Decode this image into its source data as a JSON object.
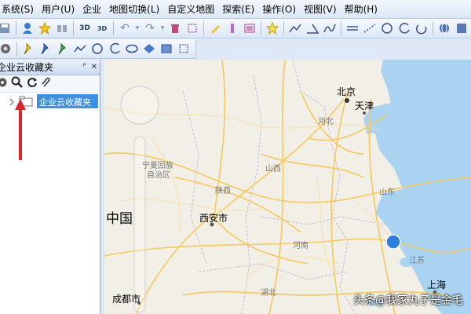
{
  "menu": [
    "系统(S)",
    "用户(U)",
    "企业",
    "地图切换(L)",
    "自定义地图",
    "探索(E)",
    "操作(O)",
    "视图(V)",
    "帮助(H)"
  ],
  "toolbar": {
    "btn_3d": "3D",
    "btn_3d2": "3D"
  },
  "panel": {
    "title": "企业云收藏夹",
    "tree_node": "企业云收藏夹"
  },
  "map_labels": {
    "beijing": "北京",
    "tianjin": "天津",
    "hebei": "河北",
    "shanxi": "山西",
    "ningxia": "宁夏回族",
    "ningxia2": "自治区",
    "shaanxi": "陕西",
    "xian": "西安市",
    "henan": "河南",
    "shandong": "山东",
    "jiangsu": "江苏",
    "shanghai": "上海",
    "hubei": "湖北",
    "chengdu": "成都市",
    "china": "中国"
  },
  "watermark": "头条@我家丸子是金毛",
  "colors": {
    "water": "#a9d3f1",
    "land": "#f2efe6",
    "road": "#f6c85f",
    "accent": "#3f8fe3",
    "marker": "#2f7fe0"
  }
}
